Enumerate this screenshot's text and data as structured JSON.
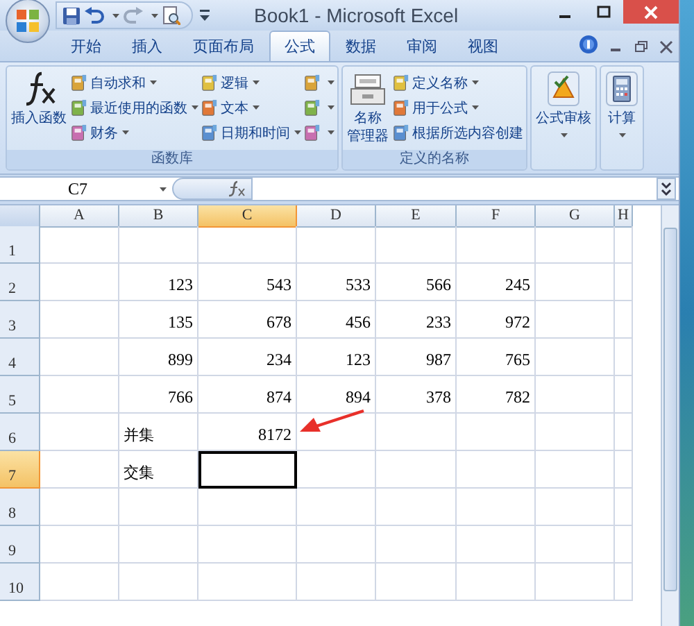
{
  "window": {
    "title": "Book1 - Microsoft Excel"
  },
  "tabs": [
    {
      "label": "开始",
      "selected": false
    },
    {
      "label": "插入",
      "selected": false
    },
    {
      "label": "页面布局",
      "selected": false
    },
    {
      "label": "公式",
      "selected": true
    },
    {
      "label": "数据",
      "selected": false
    },
    {
      "label": "审阅",
      "selected": false
    },
    {
      "label": "视图",
      "selected": false
    }
  ],
  "ribbon": {
    "groups": [
      {
        "label": "函数库",
        "large_buttons": [
          {
            "lines": [
              "插入函数"
            ],
            "dropdown": false
          }
        ],
        "columns": [
          [
            {
              "label": "自动求和",
              "dropdown": true
            },
            {
              "label": "最近使用的函数",
              "dropdown": true
            },
            {
              "label": "财务",
              "dropdown": true
            }
          ],
          [
            {
              "label": "逻辑",
              "dropdown": true
            },
            {
              "label": "文本",
              "dropdown": true
            },
            {
              "label": "日期和时间",
              "dropdown": true
            }
          ],
          [
            {
              "dropdown": true
            },
            {
              "dropdown": true
            },
            {
              "dropdown": true
            }
          ]
        ]
      },
      {
        "label": "定义的名称",
        "large_buttons": [
          {
            "lines": [
              "名称",
              "管理器"
            ],
            "dropdown": false
          }
        ],
        "columns": [
          [
            {
              "label": "定义名称",
              "dropdown": true
            },
            {
              "label": "用于公式",
              "dropdown": true
            },
            {
              "label": "根据所选内容创建",
              "dropdown": false
            }
          ]
        ]
      },
      {
        "large_buttons": [
          {
            "lines": [
              "公式审核"
            ],
            "dropdown": true
          }
        ]
      },
      {
        "large_buttons": [
          {
            "lines": [
              "计算"
            ],
            "dropdown": true
          }
        ]
      }
    ]
  },
  "formula_bar": {
    "name_box": "C7"
  },
  "sheet": {
    "columns": [
      {
        "label": "A",
        "selected": false
      },
      {
        "label": "B",
        "selected": false
      },
      {
        "label": "C",
        "selected": true
      },
      {
        "label": "D",
        "selected": false
      },
      {
        "label": "E",
        "selected": false
      },
      {
        "label": "F",
        "selected": false
      },
      {
        "label": "G",
        "selected": false
      },
      {
        "label": "H",
        "selected": false
      }
    ],
    "rows": [
      {
        "label": "1",
        "selected": false,
        "cells": [
          "",
          "",
          "",
          "",
          "",
          "",
          "",
          ""
        ]
      },
      {
        "label": "2",
        "selected": false,
        "cells": [
          "",
          "123",
          "543",
          "533",
          "566",
          "245",
          "",
          ""
        ]
      },
      {
        "label": "3",
        "selected": false,
        "cells": [
          "",
          "135",
          "678",
          "456",
          "233",
          "972",
          "",
          ""
        ]
      },
      {
        "label": "4",
        "selected": false,
        "cells": [
          "",
          "899",
          "234",
          "123",
          "987",
          "765",
          "",
          ""
        ]
      },
      {
        "label": "5",
        "selected": false,
        "cells": [
          "",
          "766",
          "874",
          "894",
          "378",
          "782",
          "",
          ""
        ]
      },
      {
        "label": "6",
        "selected": false,
        "cells": [
          "",
          "并集",
          "8172",
          "",
          "",
          "",
          "",
          ""
        ]
      },
      {
        "label": "7",
        "selected": true,
        "cells": [
          "",
          "交集",
          "",
          "",
          "",
          "",
          "",
          ""
        ]
      },
      {
        "label": "8",
        "selected": false,
        "cells": [
          "",
          "",
          "",
          "",
          "",
          "",
          "",
          ""
        ]
      },
      {
        "label": "9",
        "selected": false,
        "cells": [
          "",
          "",
          "",
          "",
          "",
          "",
          "",
          ""
        ]
      },
      {
        "label": "10",
        "selected": false,
        "cells": [
          "",
          "",
          "",
          "",
          "",
          "",
          "",
          ""
        ]
      }
    ],
    "annotations": [
      {
        "kind": "arrow"
      }
    ]
  }
}
